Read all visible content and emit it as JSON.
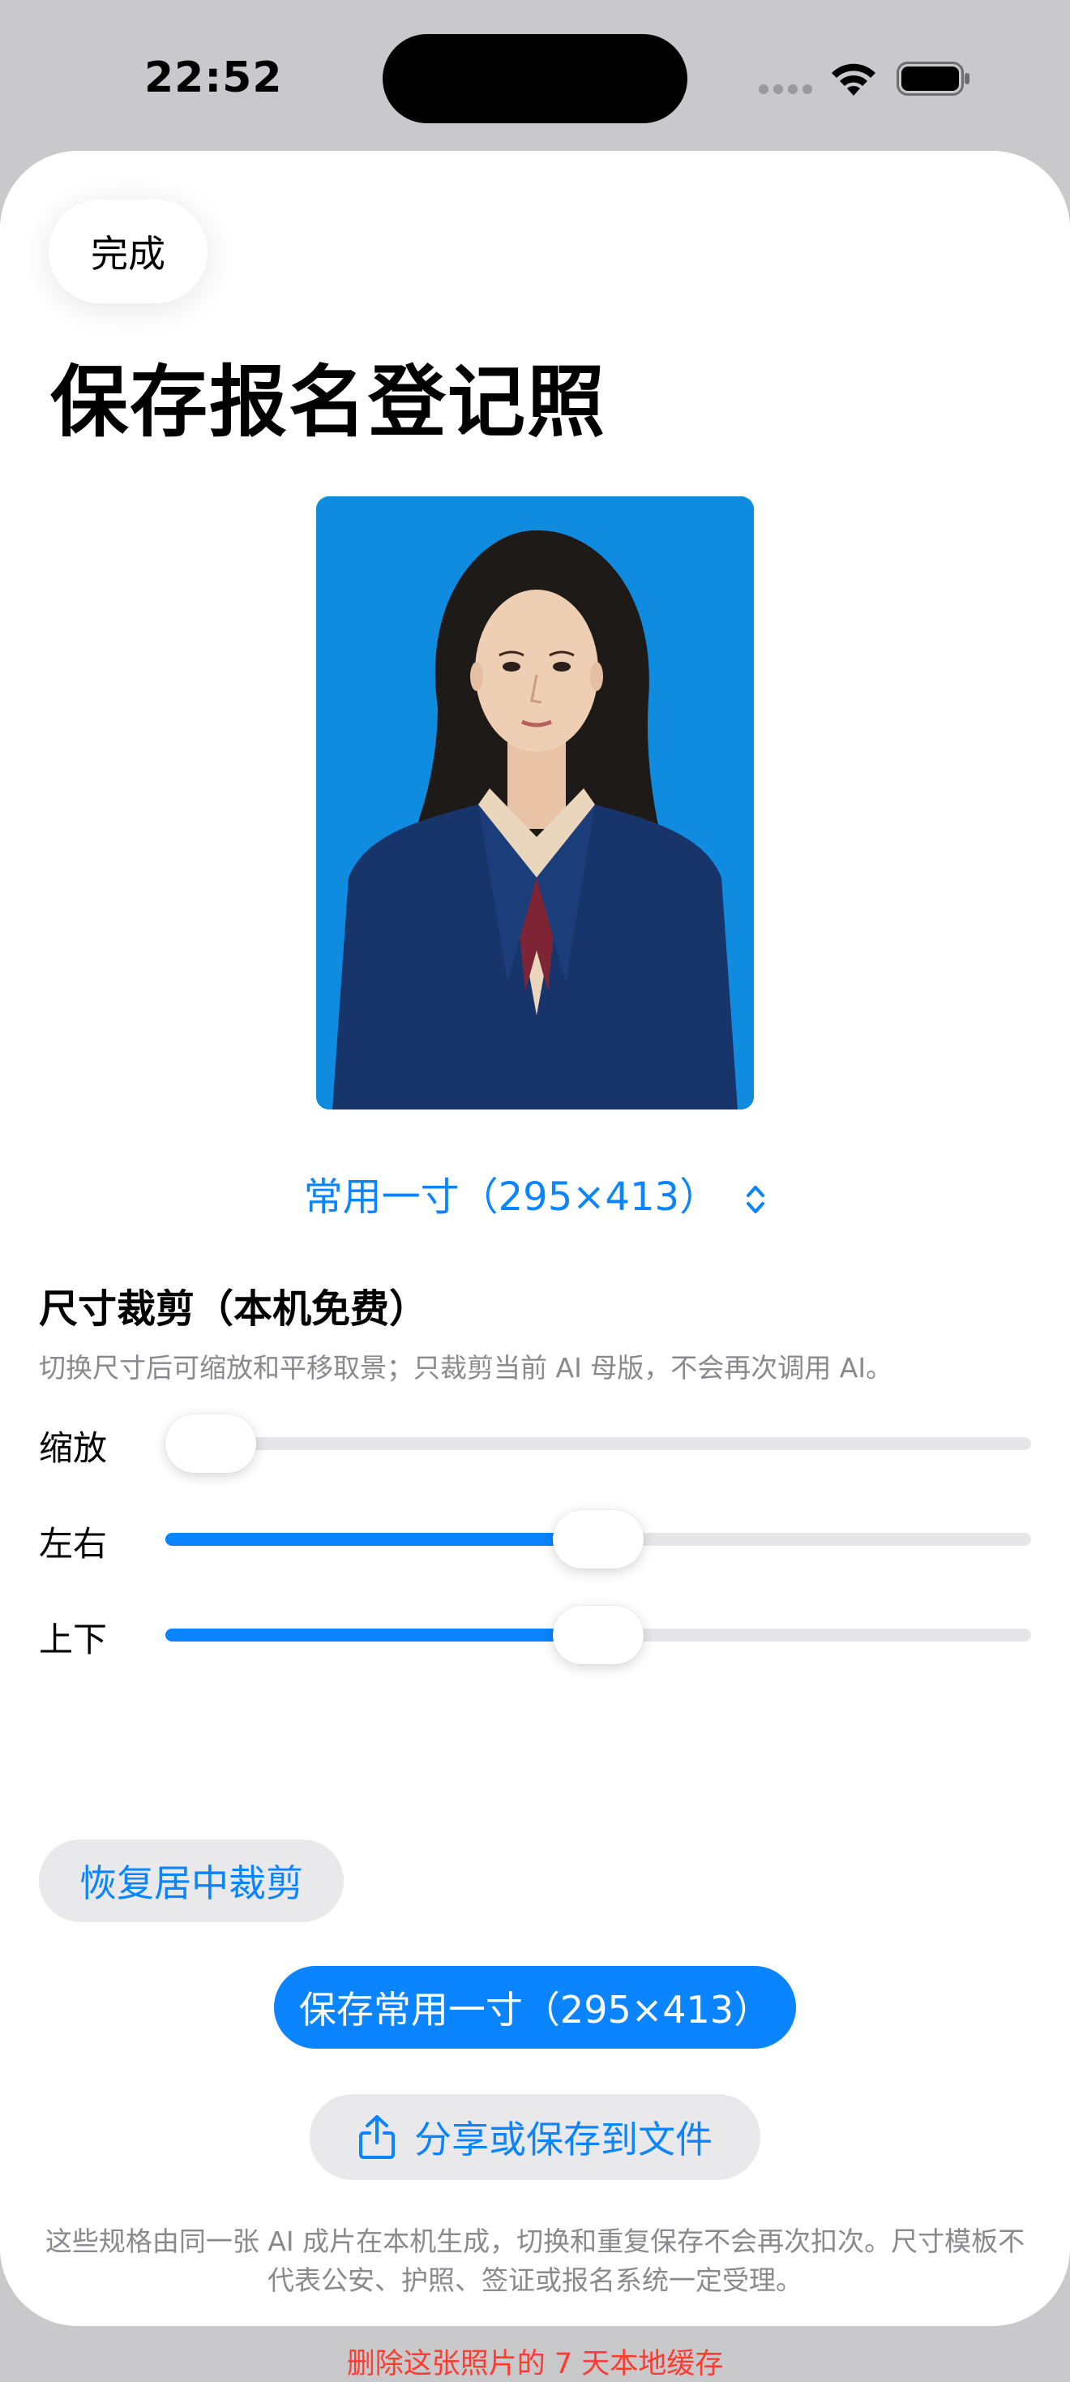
{
  "status_bar": {
    "time": "22:52"
  },
  "sheet": {
    "done_label": "完成",
    "title": "保存报名登记照"
  },
  "photo": {
    "background_color": "#0f8be0"
  },
  "size_picker": {
    "label": "常用一寸（295×413）"
  },
  "crop": {
    "title": "尺寸裁剪（本机免费）",
    "description": "切换尺寸后可缩放和平移取景；只裁剪当前 AI 母版，不会再次调用 AI。",
    "sliders": [
      {
        "label": "缩放",
        "value": 0.0
      },
      {
        "label": "左右",
        "value": 0.5
      },
      {
        "label": "上下",
        "value": 0.5
      }
    ],
    "reset_label": "恢复居中裁剪"
  },
  "actions": {
    "save_label": "保存常用一寸（295×413）",
    "share_label": "分享或保存到文件",
    "share_icon": "share-icon"
  },
  "disclaimer": "这些规格由同一张 AI 成片在本机生成，切换和重复保存不会再次扣次。尺寸模板不代表公安、护照、签证或报名系统一定受理。",
  "delete_link": "删除这张照片的 7 天本地缓存",
  "colors": {
    "accent": "#0a84ff",
    "destructive": "#ff3b30",
    "secondary_text": "#8a8a8e"
  }
}
